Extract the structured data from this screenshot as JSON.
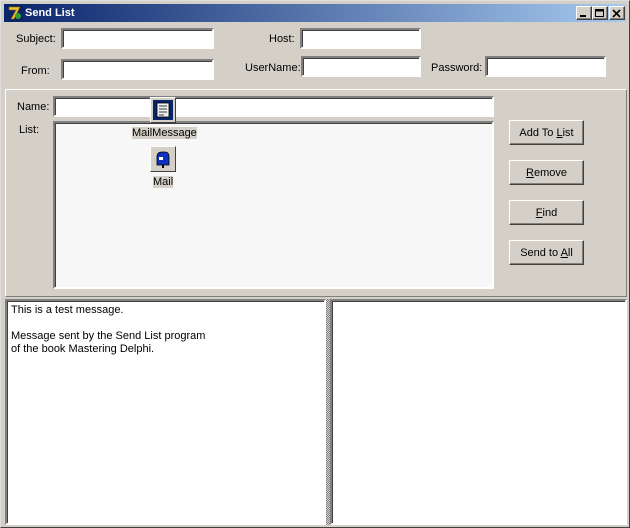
{
  "window": {
    "title": "Send List",
    "controls": [
      "minimize-icon",
      "maximize-icon",
      "close-icon"
    ]
  },
  "header": {
    "subject_label": "Subject:",
    "subject_value": "",
    "from_label": "From:",
    "from_value": "",
    "host_label": "Host:",
    "host_value": "",
    "username_label": "UserName:",
    "username_value": "",
    "password_label": "Password:",
    "password_value": ""
  },
  "panel": {
    "name_label": "Name:",
    "name_value": "",
    "list_label": "List:",
    "list_items": [],
    "components": [
      {
        "label": "MailMessage",
        "icon": "scroll-icon"
      },
      {
        "label": "Mail",
        "icon": "mailbox-icon"
      }
    ],
    "buttons": {
      "add_to_list": {
        "pre": "Add To ",
        "ul": "L",
        "post": "ist"
      },
      "remove": {
        "pre": "",
        "ul": "R",
        "post": "emove"
      },
      "find": {
        "pre": "",
        "ul": "F",
        "post": "ind"
      },
      "send_to_all": {
        "pre": "Send to ",
        "ul": "A",
        "post": "ll"
      }
    }
  },
  "memos": {
    "left_text": "This is a test message.\n\nMessage sent by the Send List program\nof the book Mastering Delphi.",
    "right_text": ""
  },
  "colors": {
    "face": "#d4d0c8",
    "title_start": "#0a246a",
    "title_end": "#a6caf0"
  }
}
